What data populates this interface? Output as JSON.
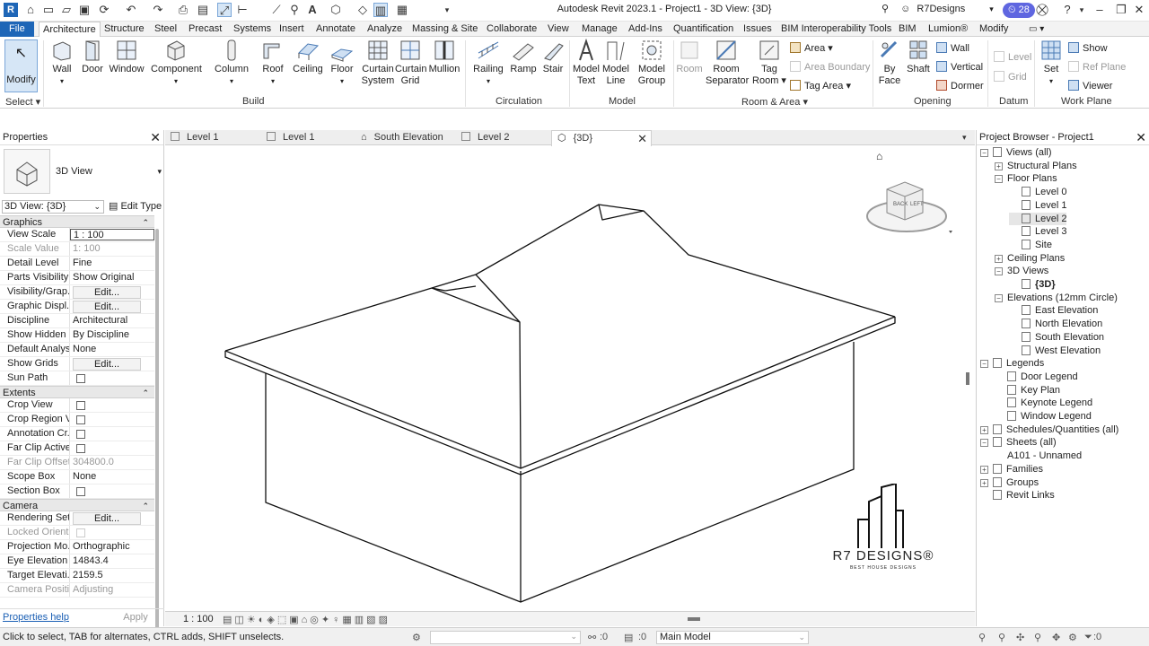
{
  "app": {
    "title": "Autodesk Revit 2023.1 - Project1 - 3D View: {3D}",
    "user": "R7Designs",
    "notifications": "28"
  },
  "tabs": [
    "File",
    "Architecture",
    "Structure",
    "Steel",
    "Precast",
    "Systems",
    "Insert",
    "Annotate",
    "Analyze",
    "Massing & Site",
    "Collaborate",
    "View",
    "Manage",
    "Add-Ins",
    "Quantification",
    "Issues",
    "BIM Interoperability Tools",
    "BIM",
    "Lumion®",
    "Modify"
  ],
  "active_tab": "Architecture",
  "ribbon": {
    "select": {
      "modify": "Modify",
      "label": "Select"
    },
    "build": {
      "wall": "Wall",
      "door": "Door",
      "window": "Window",
      "component": "Component",
      "column": "Column",
      "roof": "Roof",
      "ceiling": "Ceiling",
      "floor": "Floor",
      "curtain_system_1": "Curtain",
      "curtain_system_2": "System",
      "curtain_grid_1": "Curtain",
      "curtain_grid_2": "Grid",
      "mullion": "Mullion",
      "label": "Build"
    },
    "circulation": {
      "railing": "Railing",
      "ramp": "Ramp",
      "stair": "Stair",
      "label": "Circulation"
    },
    "model": {
      "model_text_1": "Model",
      "model_text_2": "Text",
      "model_line_1": "Model",
      "model_line_2": "Line",
      "model_group_1": "Model",
      "model_group_2": "Group",
      "label": "Model"
    },
    "room_area": {
      "room": "Room",
      "room_separator_1": "Room",
      "room_separator_2": "Separator",
      "tag_room_1": "Tag",
      "tag_room_2": "Room",
      "area": "Area",
      "area_boundary": "Area  Boundary",
      "tag_area": "Tag  Area",
      "label": "Room & Area"
    },
    "opening": {
      "by_face_1": "By",
      "by_face_2": "Face",
      "shaft": "Shaft",
      "wall": "Wall",
      "vertical": "Vertical",
      "dormer": "Dormer",
      "label": "Opening"
    },
    "datum": {
      "level": "Level",
      "grid": "Grid",
      "label": "Datum"
    },
    "work_plane": {
      "set": "Set",
      "show": "Show",
      "ref_plane": "Ref  Plane",
      "viewer": "Viewer",
      "label": "Work Plane"
    }
  },
  "properties": {
    "title": "Properties",
    "type_name": "3D View",
    "view_selector": "3D View: {3D}",
    "edit_type": "Edit Type",
    "sections": [
      {
        "name": "Graphics",
        "rows": [
          {
            "name": "View Scale",
            "value": "1 : 100",
            "style": "box"
          },
          {
            "name": "Scale Value",
            "value": "1:    100",
            "style": "dis"
          },
          {
            "name": "Detail Level",
            "value": "Fine"
          },
          {
            "name": "Parts Visibility",
            "value": "Show Original"
          },
          {
            "name": "Visibility/Grap...",
            "value": "Edit...",
            "style": "btn"
          },
          {
            "name": "Graphic Displ...",
            "value": "Edit...",
            "style": "btn"
          },
          {
            "name": "Discipline",
            "value": "Architectural"
          },
          {
            "name": "Show Hidden ...",
            "value": "By Discipline"
          },
          {
            "name": "Default Analys...",
            "value": "None"
          },
          {
            "name": "Show Grids",
            "value": "Edit...",
            "style": "btn"
          },
          {
            "name": "Sun Path",
            "value": "",
            "style": "chk"
          }
        ]
      },
      {
        "name": "Extents",
        "rows": [
          {
            "name": "Crop View",
            "value": "",
            "style": "chk"
          },
          {
            "name": "Crop Region V...",
            "value": "",
            "style": "chk"
          },
          {
            "name": "Annotation Cr...",
            "value": "",
            "style": "chk"
          },
          {
            "name": "Far Clip Active",
            "value": "",
            "style": "chk"
          },
          {
            "name": "Far Clip Offset",
            "value": "304800.0",
            "style": "dis"
          },
          {
            "name": "Scope Box",
            "value": "None"
          },
          {
            "name": "Section Box",
            "value": "",
            "style": "chk"
          }
        ]
      },
      {
        "name": "Camera",
        "rows": [
          {
            "name": "Rendering Set...",
            "value": "Edit...",
            "style": "btn"
          },
          {
            "name": "Locked Orient...",
            "value": "",
            "style": "dischk"
          },
          {
            "name": "Projection Mo...",
            "value": "Orthographic"
          },
          {
            "name": "Eye Elevation",
            "value": "14843.4"
          },
          {
            "name": "Target Elevati...",
            "value": "2159.5"
          },
          {
            "name": "Camera Positi...",
            "value": "Adjusting",
            "style": "dis"
          }
        ]
      }
    ],
    "help": "Properties help",
    "apply": "Apply"
  },
  "view_tabs": [
    {
      "label": "Level 1"
    },
    {
      "label": "Level 1"
    },
    {
      "label": "South Elevation"
    },
    {
      "label": "Level 2"
    },
    {
      "label": "{3D}",
      "active": true
    }
  ],
  "canvas": {
    "logo_text": "R7 DESIGNS®",
    "logo_sub": "BEST HOUSE DESIGNS",
    "cube_back": "BACK",
    "cube_left": "LEFT"
  },
  "view_control": {
    "scale": "1 : 100"
  },
  "browser": {
    "title": "Project Browser - Project1",
    "nodes": [
      {
        "label": "Views (all)",
        "level": 0,
        "exp": "−",
        "icon": true
      },
      {
        "label": "Structural Plans",
        "level": 1,
        "exp": "+"
      },
      {
        "label": "Floor Plans",
        "level": 1,
        "exp": "−"
      },
      {
        "label": "Level 0",
        "level": 2,
        "icon": true
      },
      {
        "label": "Level 1",
        "level": 2,
        "icon": true
      },
      {
        "label": "Level 2",
        "level": 2,
        "icon": true,
        "selected": true
      },
      {
        "label": "Level 3",
        "level": 2,
        "icon": true
      },
      {
        "label": "Site",
        "level": 2,
        "icon": true
      },
      {
        "label": "Ceiling Plans",
        "level": 1,
        "exp": "+"
      },
      {
        "label": "3D Views",
        "level": 1,
        "exp": "−"
      },
      {
        "label": "{3D}",
        "level": 2,
        "icon": true,
        "bold": true
      },
      {
        "label": "Elevations (12mm Circle)",
        "level": 1,
        "exp": "−"
      },
      {
        "label": "East Elevation",
        "level": 2,
        "icon": true
      },
      {
        "label": "North Elevation",
        "level": 2,
        "icon": true
      },
      {
        "label": "South Elevation",
        "level": 2,
        "icon": true
      },
      {
        "label": "West Elevation",
        "level": 2,
        "icon": true
      },
      {
        "label": "Legends",
        "level": 0,
        "exp": "−",
        "icon": true
      },
      {
        "label": "Door Legend",
        "level": 1,
        "icon": true
      },
      {
        "label": "Key Plan",
        "level": 1,
        "icon": true
      },
      {
        "label": "Keynote Legend",
        "level": 1,
        "icon": true
      },
      {
        "label": "Window Legend",
        "level": 1,
        "icon": true
      },
      {
        "label": "Schedules/Quantities (all)",
        "level": 0,
        "exp": "+",
        "icon": true
      },
      {
        "label": "Sheets (all)",
        "level": 0,
        "exp": "−",
        "icon": true
      },
      {
        "label": "A101 - Unnamed",
        "level": 1
      },
      {
        "label": "Families",
        "level": 0,
        "exp": "+",
        "icon": true
      },
      {
        "label": "Groups",
        "level": 0,
        "exp": "+",
        "icon": true
      },
      {
        "label": "Revit Links",
        "level": 0,
        "icon": true
      }
    ]
  },
  "status": {
    "message": "Click to select, TAB for alternates, CTRL adds, SHIFT unselects.",
    "zero_a": ":0",
    "zero_b": ":0",
    "model": "Main Model",
    "filter": ":0"
  }
}
